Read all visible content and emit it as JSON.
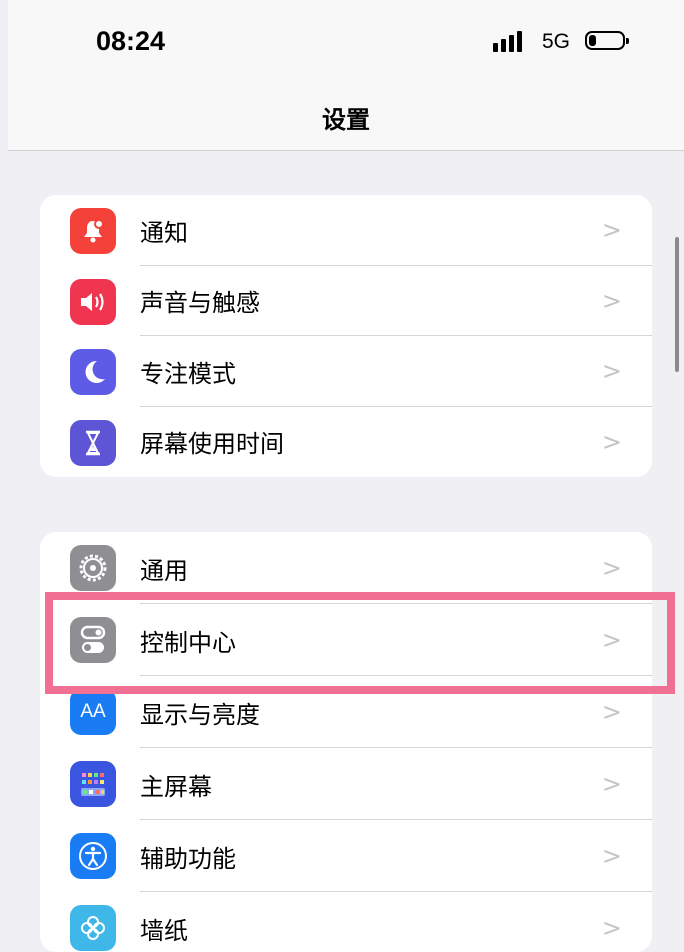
{
  "status_bar": {
    "time": "08:24",
    "network": "5G",
    "signal_icon": "signal-dots-icon",
    "battery_icon": "battery-icon"
  },
  "nav": {
    "title": "设置"
  },
  "colors": {
    "notifications": "#f4423a",
    "sounds": "#ef3550",
    "focus": "#5e5ce6",
    "screen_time": "#5e55d6",
    "general": "#8e8e93",
    "control_center": "#8e8e93",
    "display": "#1a7cf5",
    "home_screen": "#3a56e0",
    "accessibility": "#1a7cf5",
    "wallpaper": "#3fb7e8",
    "highlight": "#ef7093"
  },
  "group1": [
    {
      "label": "通知",
      "icon": "bell-icon"
    },
    {
      "label": "声音与触感",
      "icon": "speaker-icon"
    },
    {
      "label": "专注模式",
      "icon": "moon-icon"
    },
    {
      "label": "屏幕使用时间",
      "icon": "hourglass-icon"
    }
  ],
  "group2": [
    {
      "label": "通用",
      "icon": "gear-icon"
    },
    {
      "label": "控制中心",
      "icon": "toggles-icon"
    },
    {
      "label": "显示与亮度",
      "icon": "text-size-icon",
      "icon_text": "AA"
    },
    {
      "label": "主屏幕",
      "icon": "app-grid-icon"
    },
    {
      "label": "辅助功能",
      "icon": "accessibility-icon"
    },
    {
      "label": "墙纸",
      "icon": "flower-icon"
    }
  ],
  "chevron": ">"
}
